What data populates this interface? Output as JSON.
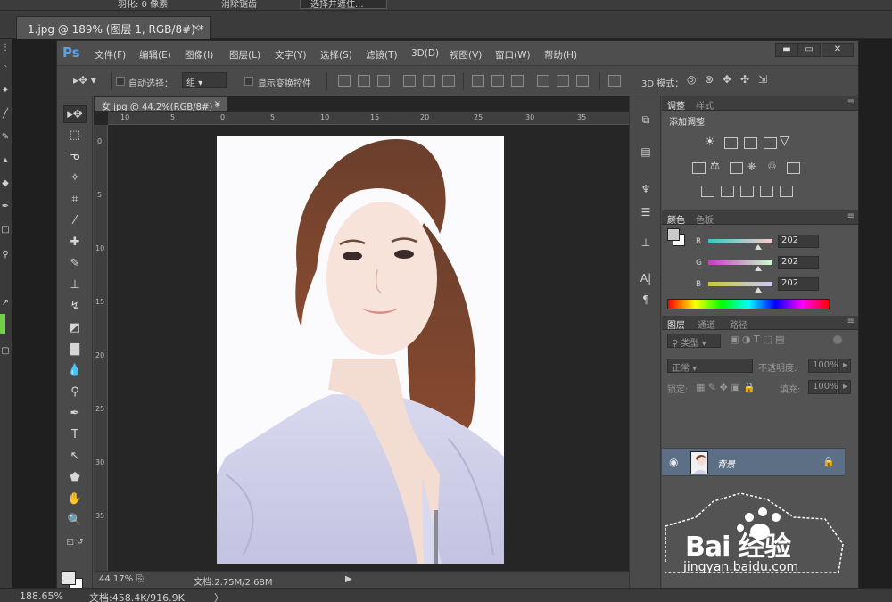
{
  "outer": {
    "options_bar": {
      "item1": "羽化: 0 像素",
      "item2": "消除锯齿",
      "item3": "选择并遮住..."
    },
    "tab_title": "1.jpg @ 189% (图层 1, RGB/8#) *",
    "tab_close": "×",
    "status": {
      "zoom": "188.65%",
      "doc": "文档:458.4K/916.9K",
      "arrow": "〉"
    }
  },
  "app": {
    "logo": "Ps"
  },
  "menu": [
    "文件(F)",
    "编辑(E)",
    "图像(I)",
    "图层(L)",
    "文字(Y)",
    "选择(S)",
    "滤镜(T)",
    "3D(D)",
    "视图(V)",
    "窗口(W)",
    "帮助(H)"
  ],
  "window_buttons": {
    "minimize": "▬",
    "maximize": "▭",
    "close": "✕"
  },
  "options": {
    "auto_select_label": "自动选择：",
    "auto_select_value": "组",
    "show_transform_label": "显示变换控件",
    "mode_3d_label": "3D 模式："
  },
  "document": {
    "tab_title": "女.jpg @ 44.2%(RGB/8#) *",
    "tab_close": "×",
    "ruler_top": [
      "10",
      "5",
      "0",
      "5",
      "10",
      "15",
      "20",
      "25",
      "30",
      "35"
    ],
    "ruler_left": [
      "0",
      "5",
      "10",
      "15",
      "20",
      "25",
      "30",
      "35"
    ],
    "zoom": "44.17%",
    "doc_size": "文档:2.75M/2.68M",
    "status_arrow": "▶"
  },
  "adjustments": {
    "tab_active": "调整",
    "tab_other": "样式",
    "title": "添加调整"
  },
  "color": {
    "tab_active": "颜色",
    "tab_other": "色板",
    "channels": [
      {
        "label": "R",
        "value": "202"
      },
      {
        "label": "G",
        "value": "202"
      },
      {
        "label": "B",
        "value": "202"
      }
    ]
  },
  "layers": {
    "tabs": [
      "图层",
      "通道",
      "路径"
    ],
    "filter_kind": "类型",
    "blend_mode": "正常",
    "opacity_label": "不透明度:",
    "opacity_value": "100%",
    "lock_label": "锁定:",
    "fill_label": "填充:",
    "fill_value": "100%",
    "items": [
      {
        "name": "背景",
        "visible": true,
        "locked": true
      }
    ]
  },
  "watermark": {
    "main": "Bai 经验",
    "url": "jingyan.baidu.com"
  },
  "colors": {
    "ps_blue": "#5aa0e6",
    "layer_selected": "#5d6f85",
    "panel_bg": "#535353"
  }
}
